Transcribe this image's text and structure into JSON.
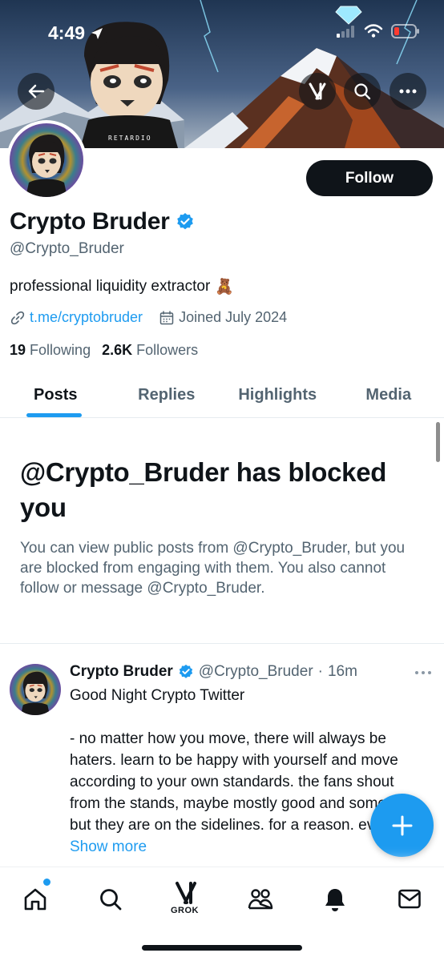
{
  "status_bar": {
    "time": "4:49"
  },
  "header": {
    "back_icon": "arrow-left-icon",
    "grok_icon": "grok-icon",
    "search_icon": "search-icon",
    "more_icon": "more-horizontal-icon"
  },
  "profile": {
    "name": "Crypto Bruder",
    "handle": "@Crypto_Bruder",
    "bio": "professional liquidity extractor",
    "bio_emoji": "🧸",
    "link": "t.me/cryptobruder",
    "joined": "Joined July 2024",
    "following_count": "19",
    "following_label": "Following",
    "followers_count": "2.6K",
    "followers_label": "Followers",
    "follow_button": "Follow",
    "verified": true,
    "avatar_shirt_text": "RETARDIO"
  },
  "tabs": [
    {
      "label": "Posts",
      "active": true
    },
    {
      "label": "Replies",
      "active": false
    },
    {
      "label": "Highlights",
      "active": false
    },
    {
      "label": "Media",
      "active": false
    }
  ],
  "blocked": {
    "title": "@Crypto_Bruder has blocked you",
    "body": "You can view public posts from @Crypto_Bruder, but you are blocked from engaging with them. You also cannot follow or message @Crypto_Bruder."
  },
  "post": {
    "author": "Crypto Bruder",
    "handle": "@Crypto_Bruder",
    "separator": "·",
    "time": "16m",
    "line1": "Good Night Crypto Twitter",
    "line2": "- no matter how you move, there will always be haters. learn to be happy with yourself and move according to your own standards. the fans shout from the stands, maybe mostly good and some bad, but they are on the sidelines. for a reason. even the",
    "show_more": "Show more"
  },
  "bottom_nav": {
    "items": [
      "home-icon",
      "search-icon",
      "grok-icon",
      "communities-icon",
      "notifications-icon",
      "messages-icon"
    ],
    "grok_label": "GROK"
  },
  "colors": {
    "accent": "#1d9bf0",
    "text_primary": "#0f1419",
    "text_secondary": "#536471",
    "button_dark": "#0f1419"
  }
}
